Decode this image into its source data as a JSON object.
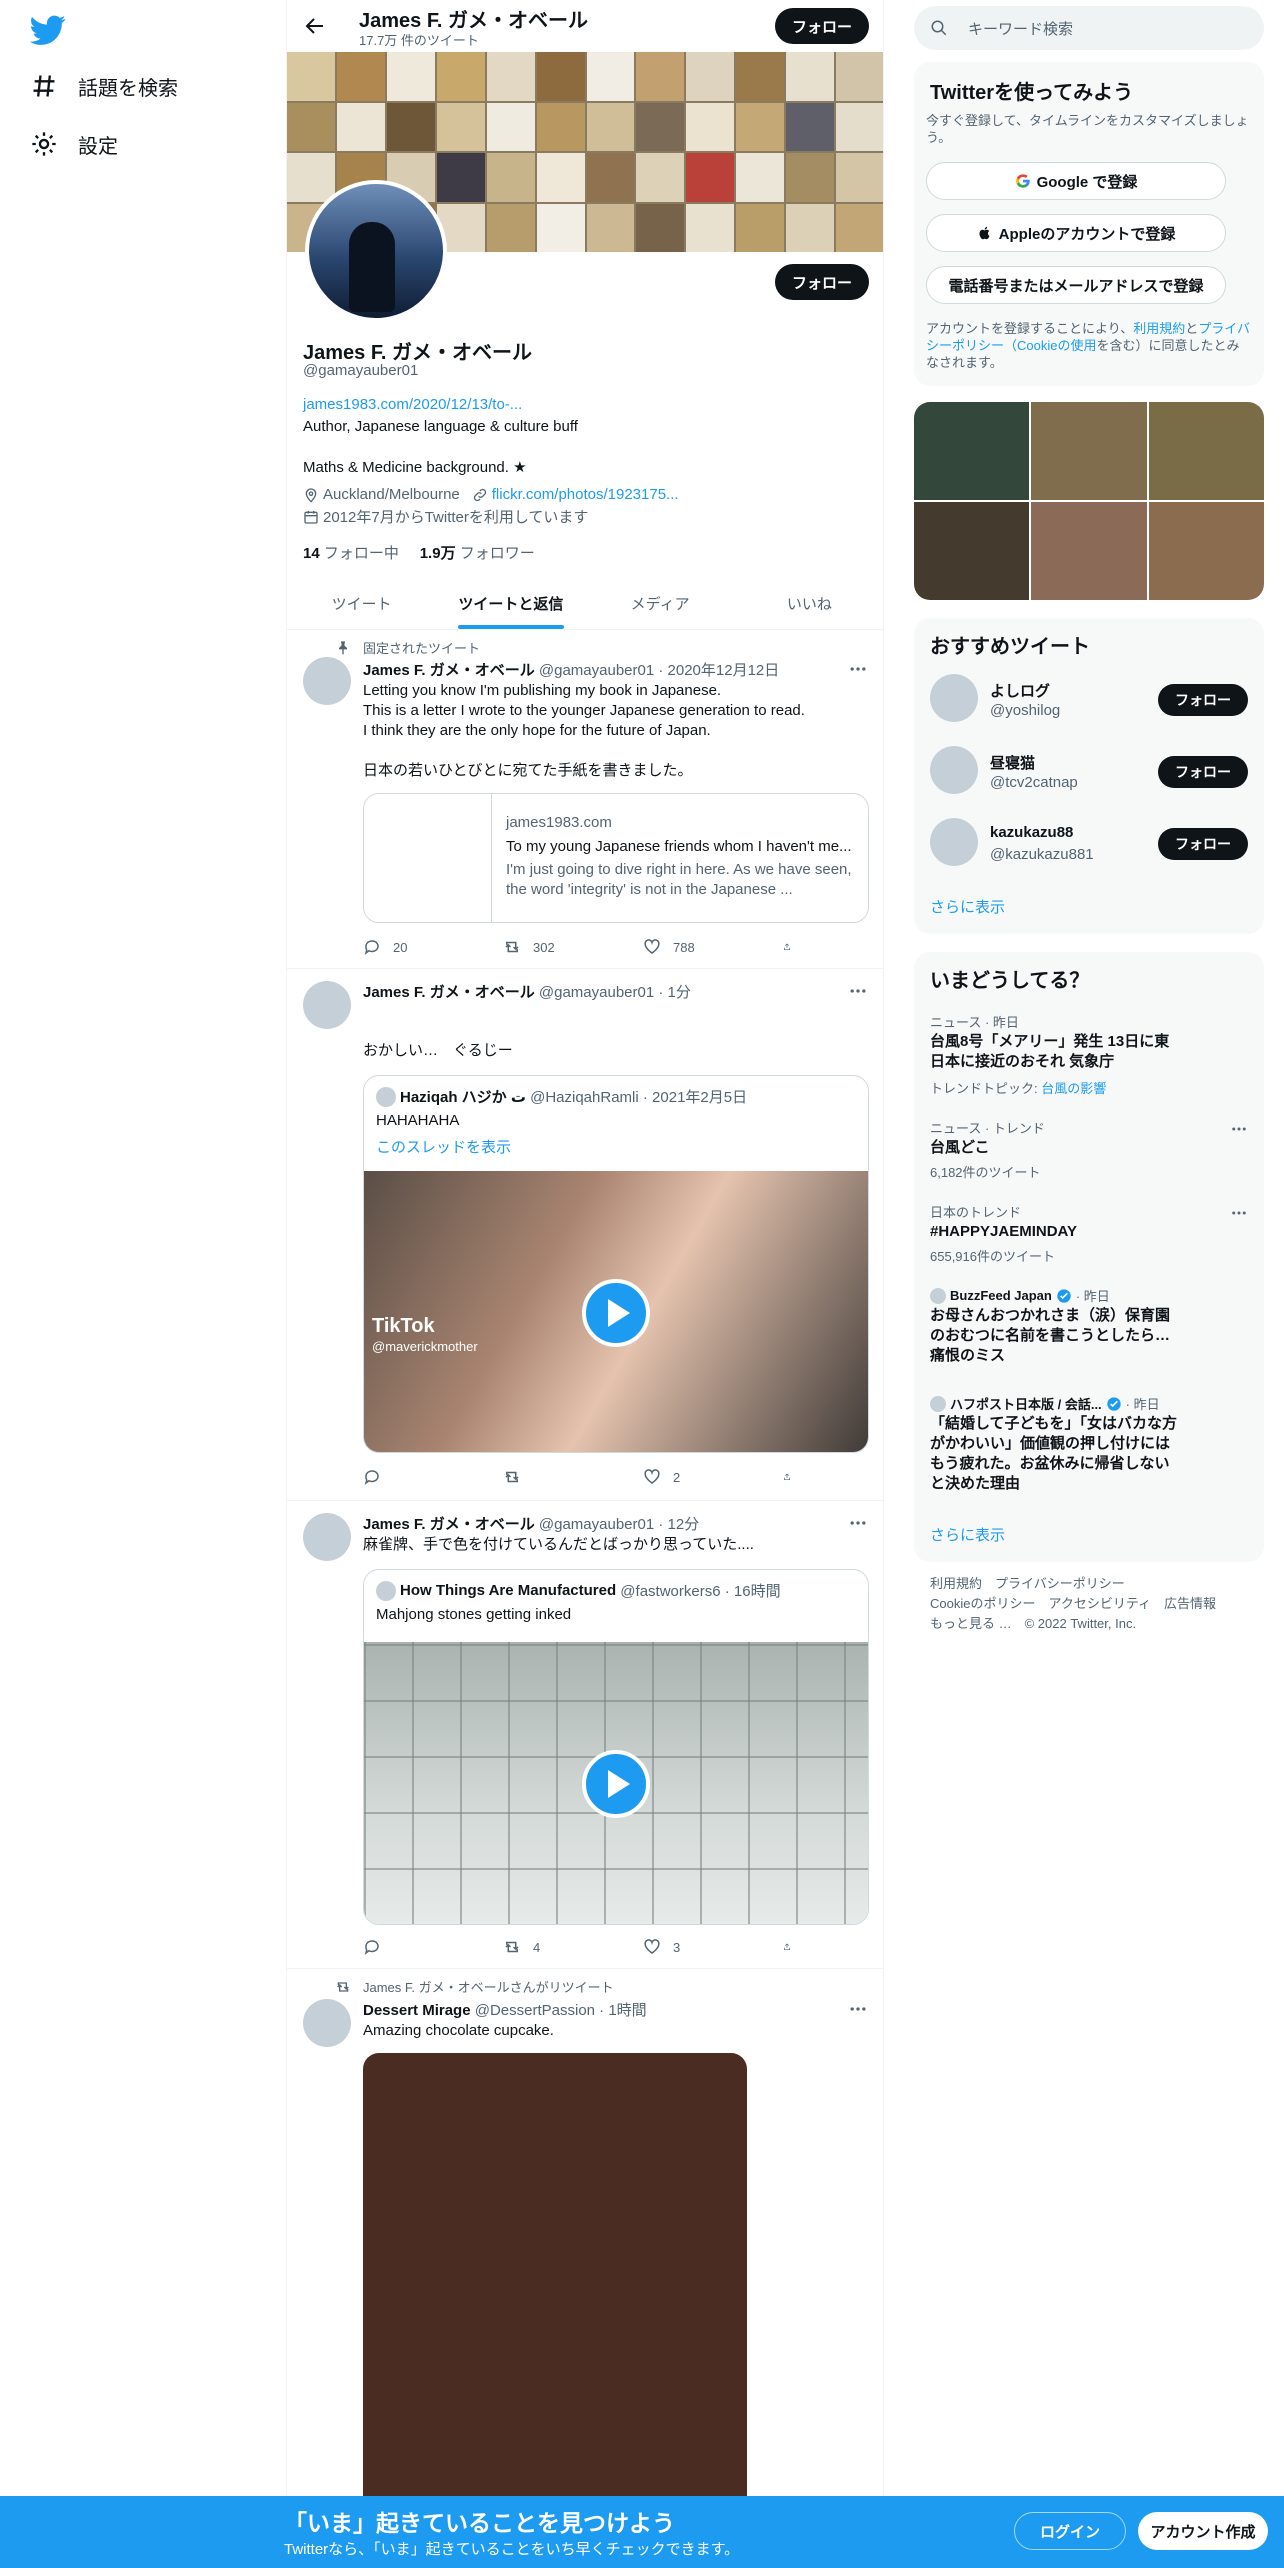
{
  "nav": {
    "explore": "話題を検索",
    "settings": "設定"
  },
  "header": {
    "name": "James F. ガメ・オベール",
    "tweet_count": "17.7万 件のツイート",
    "follow": "フォロー"
  },
  "profile": {
    "name": "James F. ガメ・オベール",
    "handle": "@gamayauber01",
    "url": "james1983.com/2020/12/13/to-...",
    "bio1": "Author, Japanese language & culture buff",
    "bio2": "Maths & Medicine background.  ★",
    "location": "Auckland/Melbourne",
    "link": "flickr.com/photos/1923175...",
    "joined": "2012年7月からTwitterを利用しています",
    "following_count": "14",
    "following_label": "フォロー中",
    "followers_count": "1.9万",
    "followers_label": "フォロワー",
    "follow_button": "フォロー"
  },
  "tabs": [
    "ツイート",
    "ツイートと返信",
    "メディア",
    "いいね"
  ],
  "tweets": [
    {
      "social": "固定されたツイート",
      "name": "James F. ガメ・オベール",
      "meta": "@gamayauber01 · 2020年12月12日",
      "text": "Letting you know I'm publishing my book in Japanese.\nThis is a letter I wrote to the younger Japanese generation to read.\nI think they are the only hope for the future of Japan.\n\n日本の若いひとびとに宛てた手紙を書きました。",
      "card_domain": "james1983.com",
      "card_title": "To my young Japanese friends whom I haven't me...",
      "card_desc": "  I'm just going to dive right in here.   As we have seen, the word 'integrity' is not in the Japanese ...",
      "replies": "20",
      "retweets": "302",
      "likes": "788"
    },
    {
      "name": "James F. ガメ・オベール",
      "meta": "@gamayauber01 · 1分",
      "text": "おかしい…　ぐるじー",
      "quote_name": "Haziqah ハジか ت",
      "quote_meta": "@HaziqahRamli · 2021年2月5日",
      "quote_text": "HAHAHAHA",
      "quote_link": "このスレッドを表示",
      "video_brand": "TikTok",
      "video_handle": "@maverickmother",
      "likes": "2"
    },
    {
      "name": "James F. ガメ・オベール",
      "meta": "@gamayauber01 · 12分",
      "text": "麻雀牌、手で色を付けているんだとばっかり思っていた....",
      "quote_name": "How Things Are Manufactured",
      "quote_meta": "@fastworkers6 · 16時間",
      "quote_text": "Mahjong stones getting inked",
      "retweets": "4",
      "likes": "3"
    },
    {
      "social": "James F. ガメ・オベールさんがリツイート",
      "name": "Dessert Mirage",
      "meta": "@DessertPassion · 1時間",
      "text": "Amazing chocolate cupcake."
    }
  ],
  "right": {
    "search_placeholder": "キーワード検索",
    "signup_title": "Twitterを使ってみよう",
    "signup_sub": "今すぐ登録して、タイムラインをカスタマイズしましょう。",
    "google": "Google で登録",
    "apple": "Appleのアカウントで登録",
    "phone": "電話番号またはメールアドレスで登録",
    "legal_1": "アカウントを登録することにより、",
    "legal_terms": "利用規約",
    "legal_2": "と",
    "legal_privacy": "プライバシーポリシー（Cookieの使用",
    "legal_3": "を含む）に同意したとみなされます。",
    "rec_title": "おすすめツイート",
    "recs": [
      {
        "name": "よしログ",
        "handle": "@yoshilog"
      },
      {
        "name": "昼寝猫",
        "handle": "@tcv2catnap"
      },
      {
        "name": "kazukazu88",
        "handle": "@kazukazu881"
      }
    ],
    "show_more": "さらに表示",
    "trends_title": "いまどうしてる？",
    "trends": [
      {
        "cat": "ニュース · 昨日",
        "title": "台風8号「メアリー」発生 13日に東日本に接近のおそれ 気象庁",
        "sub_prefix": "トレンドトピック: ",
        "sub_link": "台風の影響"
      },
      {
        "cat": "ニュース · トレンド",
        "title": "台風どこ",
        "sub": "6,182件のツイート"
      },
      {
        "cat": "日本のトレンド",
        "title": "#HAPPYJAEMINDAY",
        "sub": "655,916件のツイート"
      },
      {
        "source": "BuzzFeed Japan",
        "time": "· 昨日",
        "title": "お母さんおつかれさま（涙）保育園のおむつに名前を書こうとしたら…痛恨のミス"
      },
      {
        "source": "ハフポスト日本版 / 会話...",
        "time": "· 昨日",
        "title": "「結婚して子どもを」「女はバカな方がかわいい」価値観の押し付けにはもう疲れた。お盆休みに帰省しないと決めた理由"
      }
    ],
    "trends_more": "さらに表示",
    "footer_line1": "利用規約　プライバシーポリシー",
    "footer_line2": "Cookieのポリシー　アクセシビリティ　広告情報",
    "footer_line3": "もっと見る …　© 2022 Twitter, Inc."
  },
  "bottombar": {
    "title": "「いま」起きていることを見つけよう",
    "sub": "Twitterなら、「いま」起きていることをいち早くチェックできます。",
    "login": "ログイン",
    "signup": "アカウント作成"
  },
  "colors": {
    "accent": "#1d9bf0",
    "text": "#0f1419",
    "muted": "#536471"
  }
}
